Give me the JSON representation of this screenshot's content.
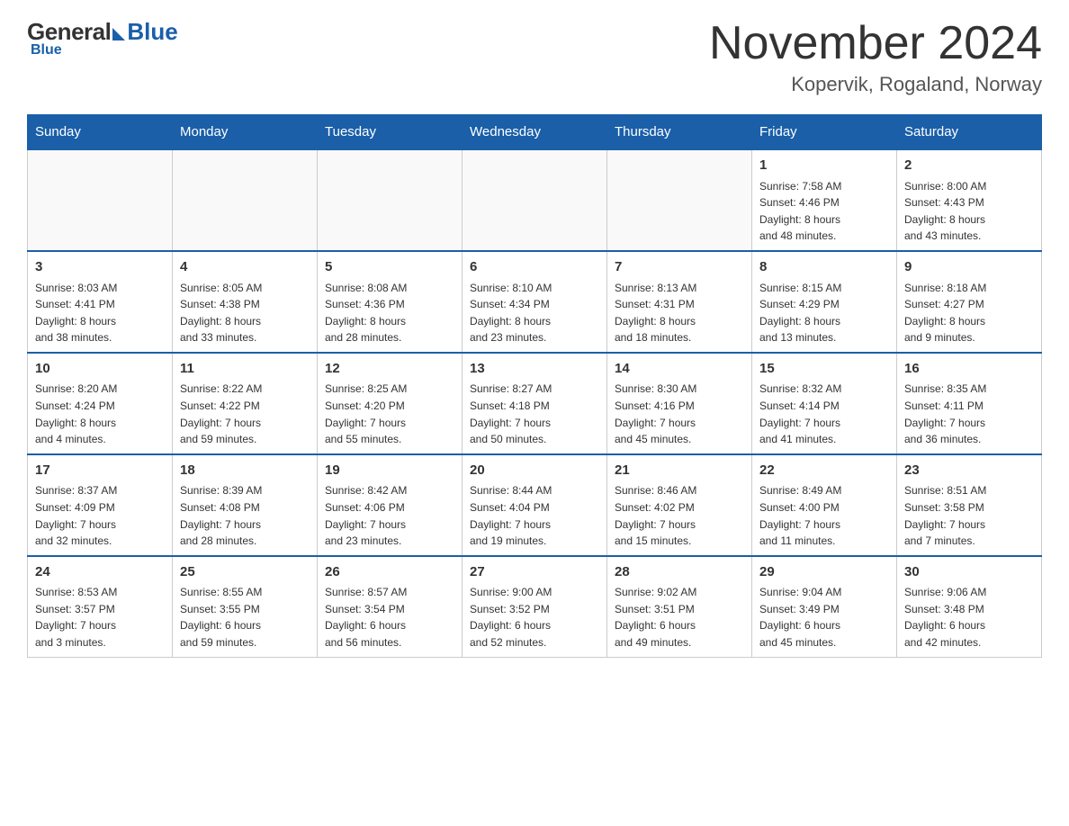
{
  "logo": {
    "general": "General",
    "blue": "Blue"
  },
  "title": "November 2024",
  "location": "Kopervik, Rogaland, Norway",
  "weekdays": [
    "Sunday",
    "Monday",
    "Tuesday",
    "Wednesday",
    "Thursday",
    "Friday",
    "Saturday"
  ],
  "weeks": [
    [
      {
        "day": "",
        "info": ""
      },
      {
        "day": "",
        "info": ""
      },
      {
        "day": "",
        "info": ""
      },
      {
        "day": "",
        "info": ""
      },
      {
        "day": "",
        "info": ""
      },
      {
        "day": "1",
        "info": "Sunrise: 7:58 AM\nSunset: 4:46 PM\nDaylight: 8 hours\nand 48 minutes."
      },
      {
        "day": "2",
        "info": "Sunrise: 8:00 AM\nSunset: 4:43 PM\nDaylight: 8 hours\nand 43 minutes."
      }
    ],
    [
      {
        "day": "3",
        "info": "Sunrise: 8:03 AM\nSunset: 4:41 PM\nDaylight: 8 hours\nand 38 minutes."
      },
      {
        "day": "4",
        "info": "Sunrise: 8:05 AM\nSunset: 4:38 PM\nDaylight: 8 hours\nand 33 minutes."
      },
      {
        "day": "5",
        "info": "Sunrise: 8:08 AM\nSunset: 4:36 PM\nDaylight: 8 hours\nand 28 minutes."
      },
      {
        "day": "6",
        "info": "Sunrise: 8:10 AM\nSunset: 4:34 PM\nDaylight: 8 hours\nand 23 minutes."
      },
      {
        "day": "7",
        "info": "Sunrise: 8:13 AM\nSunset: 4:31 PM\nDaylight: 8 hours\nand 18 minutes."
      },
      {
        "day": "8",
        "info": "Sunrise: 8:15 AM\nSunset: 4:29 PM\nDaylight: 8 hours\nand 13 minutes."
      },
      {
        "day": "9",
        "info": "Sunrise: 8:18 AM\nSunset: 4:27 PM\nDaylight: 8 hours\nand 9 minutes."
      }
    ],
    [
      {
        "day": "10",
        "info": "Sunrise: 8:20 AM\nSunset: 4:24 PM\nDaylight: 8 hours\nand 4 minutes."
      },
      {
        "day": "11",
        "info": "Sunrise: 8:22 AM\nSunset: 4:22 PM\nDaylight: 7 hours\nand 59 minutes."
      },
      {
        "day": "12",
        "info": "Sunrise: 8:25 AM\nSunset: 4:20 PM\nDaylight: 7 hours\nand 55 minutes."
      },
      {
        "day": "13",
        "info": "Sunrise: 8:27 AM\nSunset: 4:18 PM\nDaylight: 7 hours\nand 50 minutes."
      },
      {
        "day": "14",
        "info": "Sunrise: 8:30 AM\nSunset: 4:16 PM\nDaylight: 7 hours\nand 45 minutes."
      },
      {
        "day": "15",
        "info": "Sunrise: 8:32 AM\nSunset: 4:14 PM\nDaylight: 7 hours\nand 41 minutes."
      },
      {
        "day": "16",
        "info": "Sunrise: 8:35 AM\nSunset: 4:11 PM\nDaylight: 7 hours\nand 36 minutes."
      }
    ],
    [
      {
        "day": "17",
        "info": "Sunrise: 8:37 AM\nSunset: 4:09 PM\nDaylight: 7 hours\nand 32 minutes."
      },
      {
        "day": "18",
        "info": "Sunrise: 8:39 AM\nSunset: 4:08 PM\nDaylight: 7 hours\nand 28 minutes."
      },
      {
        "day": "19",
        "info": "Sunrise: 8:42 AM\nSunset: 4:06 PM\nDaylight: 7 hours\nand 23 minutes."
      },
      {
        "day": "20",
        "info": "Sunrise: 8:44 AM\nSunset: 4:04 PM\nDaylight: 7 hours\nand 19 minutes."
      },
      {
        "day": "21",
        "info": "Sunrise: 8:46 AM\nSunset: 4:02 PM\nDaylight: 7 hours\nand 15 minutes."
      },
      {
        "day": "22",
        "info": "Sunrise: 8:49 AM\nSunset: 4:00 PM\nDaylight: 7 hours\nand 11 minutes."
      },
      {
        "day": "23",
        "info": "Sunrise: 8:51 AM\nSunset: 3:58 PM\nDaylight: 7 hours\nand 7 minutes."
      }
    ],
    [
      {
        "day": "24",
        "info": "Sunrise: 8:53 AM\nSunset: 3:57 PM\nDaylight: 7 hours\nand 3 minutes."
      },
      {
        "day": "25",
        "info": "Sunrise: 8:55 AM\nSunset: 3:55 PM\nDaylight: 6 hours\nand 59 minutes."
      },
      {
        "day": "26",
        "info": "Sunrise: 8:57 AM\nSunset: 3:54 PM\nDaylight: 6 hours\nand 56 minutes."
      },
      {
        "day": "27",
        "info": "Sunrise: 9:00 AM\nSunset: 3:52 PM\nDaylight: 6 hours\nand 52 minutes."
      },
      {
        "day": "28",
        "info": "Sunrise: 9:02 AM\nSunset: 3:51 PM\nDaylight: 6 hours\nand 49 minutes."
      },
      {
        "day": "29",
        "info": "Sunrise: 9:04 AM\nSunset: 3:49 PM\nDaylight: 6 hours\nand 45 minutes."
      },
      {
        "day": "30",
        "info": "Sunrise: 9:06 AM\nSunset: 3:48 PM\nDaylight: 6 hours\nand 42 minutes."
      }
    ]
  ]
}
